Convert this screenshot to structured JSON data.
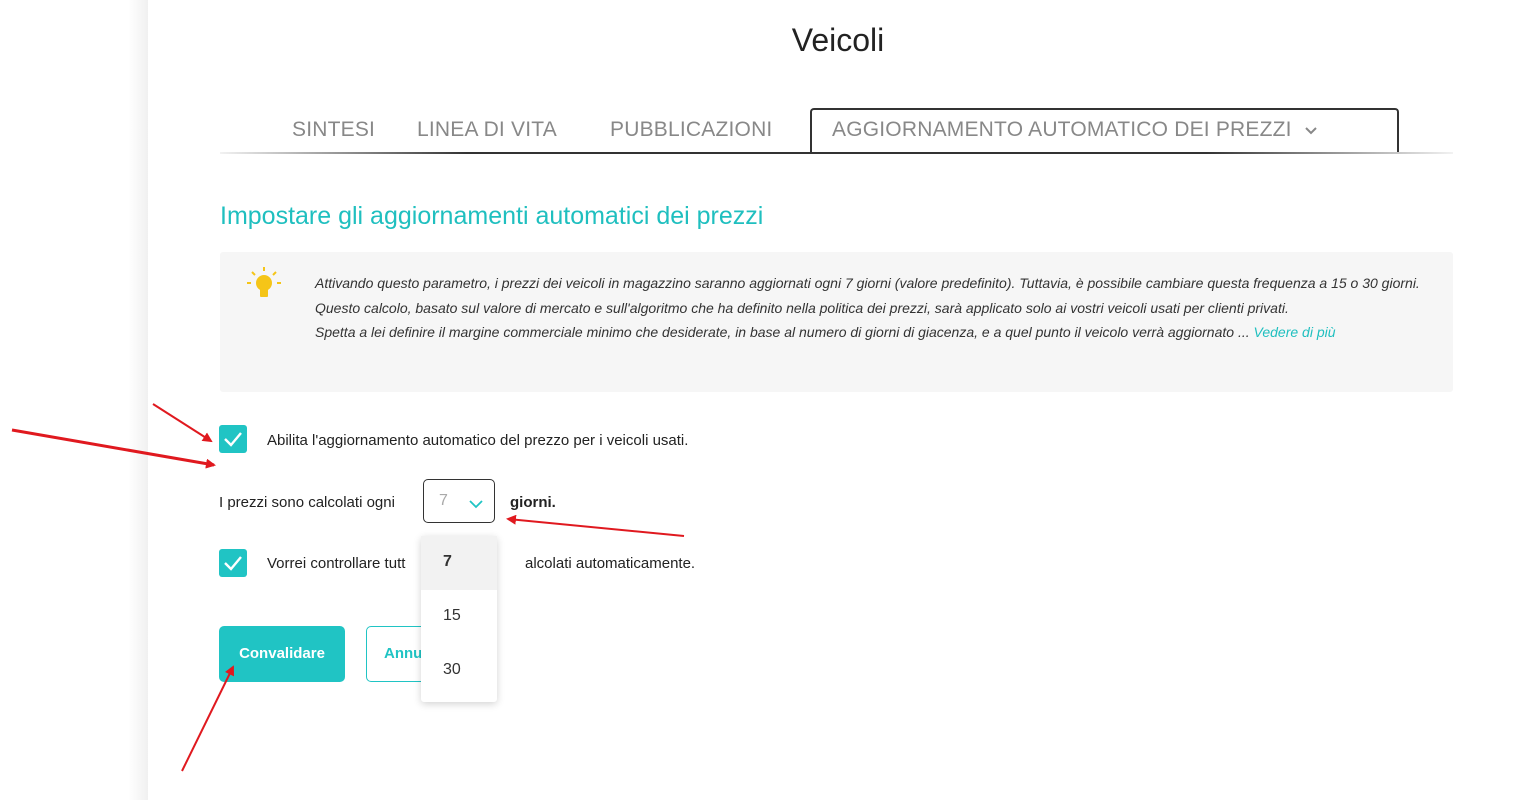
{
  "page": {
    "title": "Veicoli"
  },
  "tabs": [
    {
      "label": "SINTESI"
    },
    {
      "label": "LINEA DI VITA"
    },
    {
      "label": "PUBBLICAZIONI"
    },
    {
      "label": "AGGIORNAMENTO AUTOMATICO DEI PREZZI",
      "active": true
    }
  ],
  "section": {
    "title": "Impostare gli aggiornamenti automatici dei prezzi"
  },
  "info": {
    "line1": "Attivando questo parametro, i prezzi dei veicoli in magazzino saranno aggiornati ogni 7 giorni (valore predefinito). Tuttavia, è possibile cambiare questa frequenza a 15 o 30 giorni.",
    "line2": "Questo calcolo, basato sul valore di mercato e sull'algoritmo che ha definito nella politica dei prezzi, sarà applicato solo ai vostri veicoli usati per clienti privati.",
    "line3": "Spetta a lei definire il margine commerciale minimo che desiderate, in base al numero di giorni di giacenza, e a quel punto il veicolo verrà aggiornato ...",
    "more_link": "Vedere di più",
    "icon": "lightbulb-icon"
  },
  "form": {
    "enable_label": "Abilita l'aggiornamento automatico del prezzo per i veicoli usati.",
    "enable_checked": true,
    "frequency_label": "I prezzi sono calcolati ogni",
    "frequency_value": "7",
    "frequency_unit": "giorni.",
    "frequency_options": [
      "7",
      "15",
      "30"
    ],
    "control_label_start": "Vorrei controllare tutt",
    "control_label_end": "alcolati automaticamente.",
    "control_checked": true
  },
  "buttons": {
    "validate": "Convalidare",
    "cancel": "Annu"
  },
  "colors": {
    "accent": "#20c4c4",
    "title_accent": "#1fbfbf",
    "annotation": "#e0191f"
  }
}
